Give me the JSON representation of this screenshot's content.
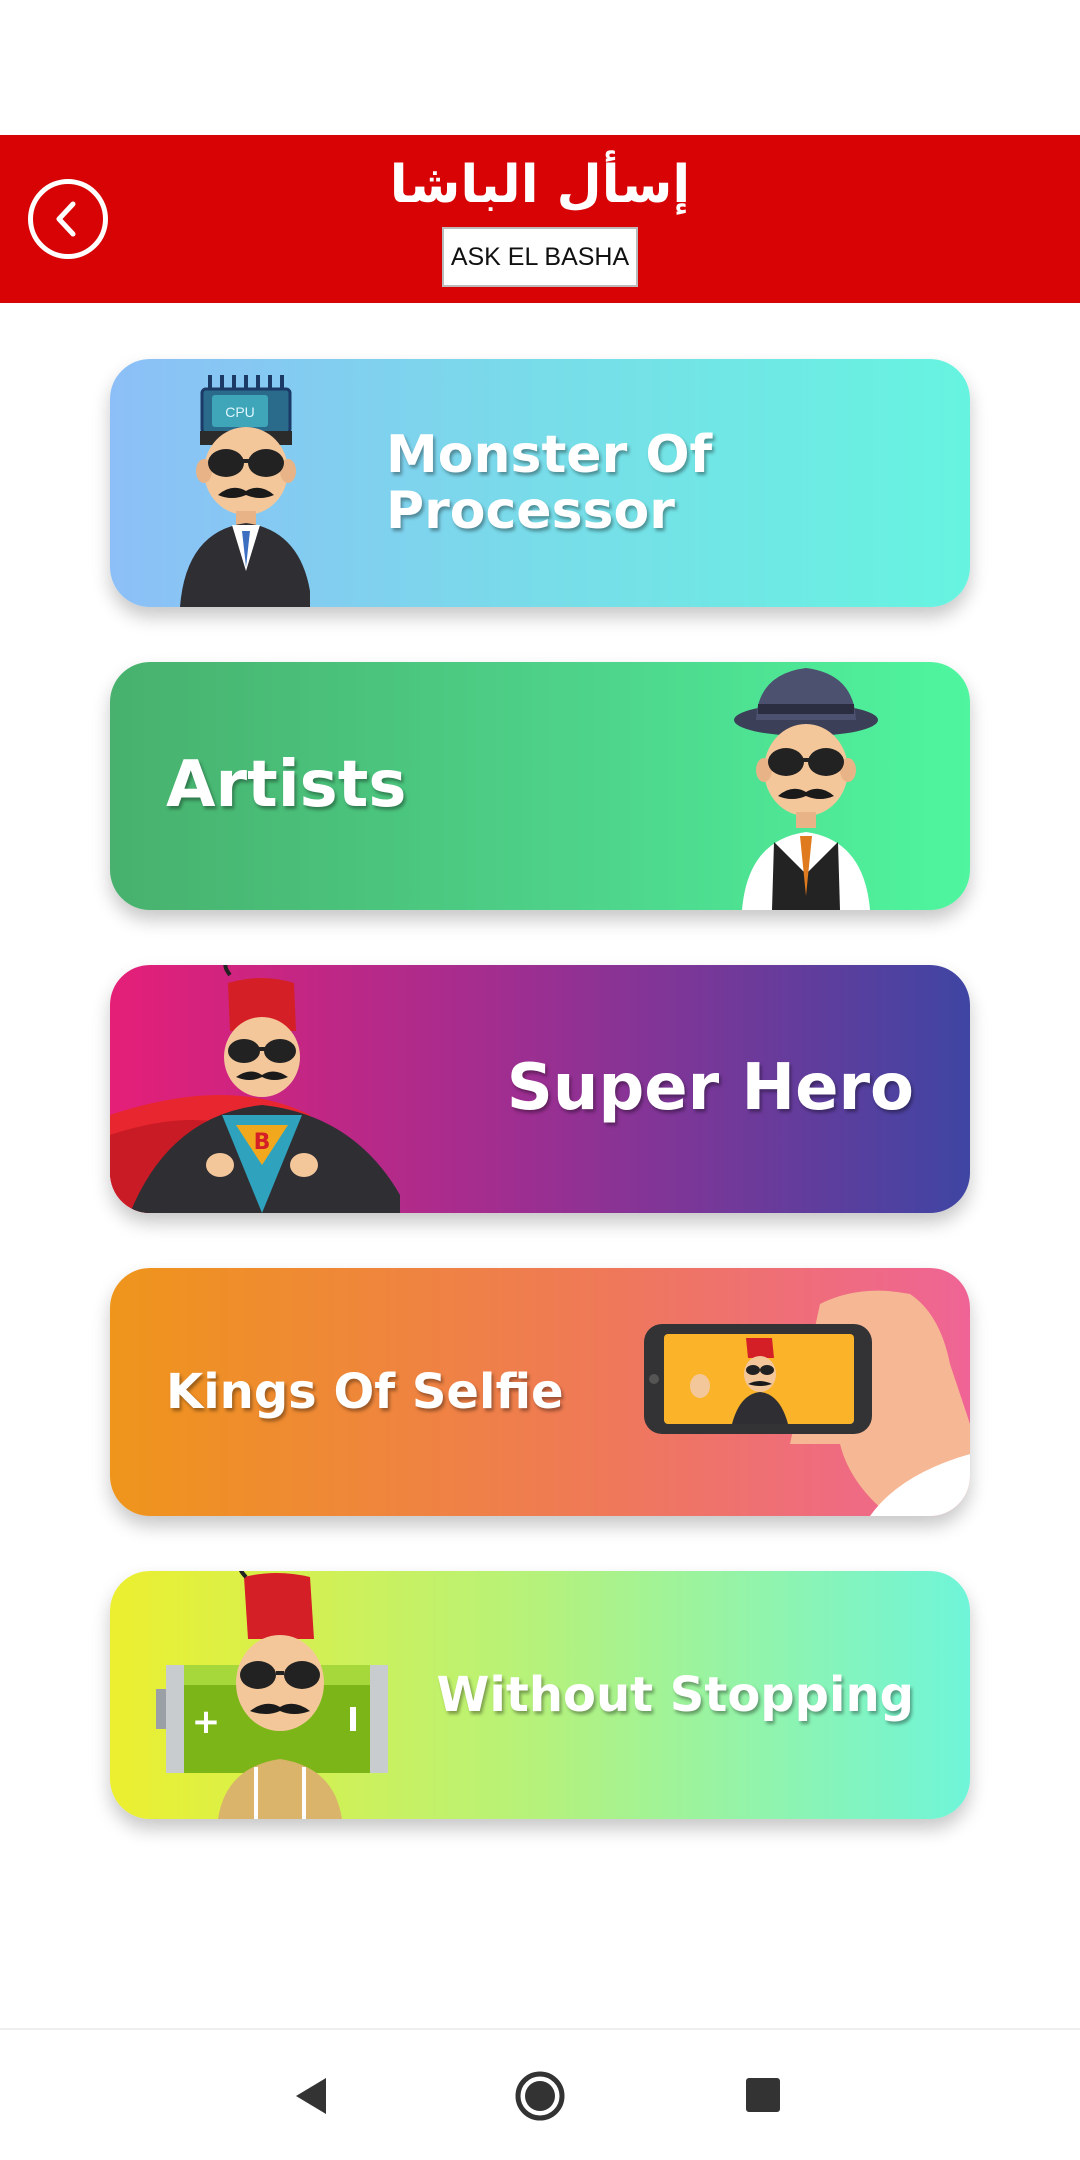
{
  "header": {
    "title_ar": "إسأل الباشا",
    "title_en": "ASK EL BASHA"
  },
  "icons": {
    "back": "chevron-left-icon",
    "nav_back": "triangle-back-icon",
    "nav_home": "circle-home-icon",
    "nav_recents": "square-recents-icon"
  },
  "colors": {
    "header_bg": "#d70304",
    "card1": [
      "#8cbff7",
      "#66f4e0"
    ],
    "card2": [
      "#47b16d",
      "#4ff69f"
    ],
    "card3": [
      "#e51f78",
      "#3f45a3"
    ],
    "card4": [
      "#ef951b",
      "#ef6496"
    ],
    "card5": [
      "#ecef2f",
      "#6ff5d9"
    ]
  },
  "categories": [
    {
      "line1": "Monster Of",
      "line2": "Processor",
      "art_text": "CPU"
    },
    {
      "label": "Artists"
    },
    {
      "label": "Super Hero",
      "art_text": "B"
    },
    {
      "label": "Kings Of Selfie"
    },
    {
      "label": "Without Stopping"
    }
  ]
}
